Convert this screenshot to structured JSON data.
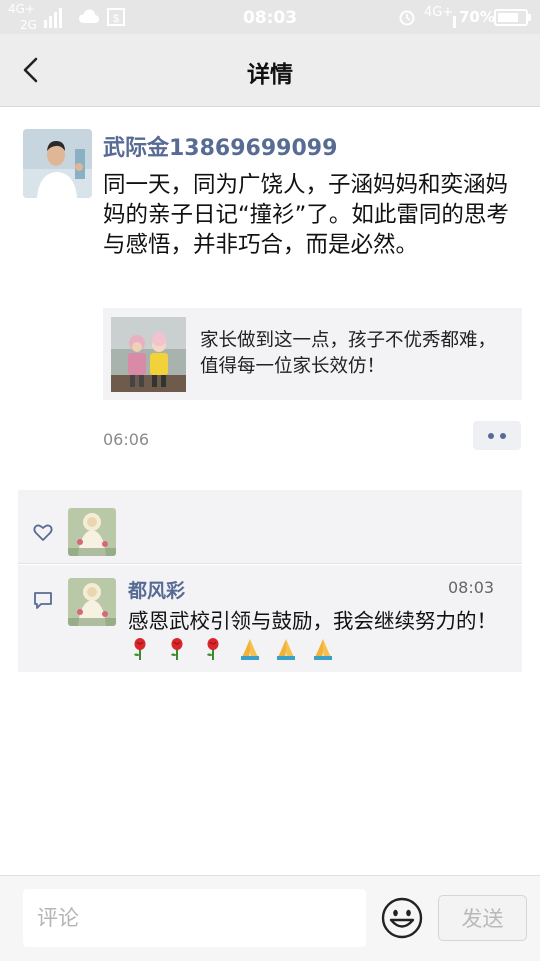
{
  "status_bar": {
    "network_1": "4G+",
    "network_2": "2G",
    "time": "08:03",
    "network_right": "4G+",
    "battery": "70%",
    "icons": [
      "signal-icon",
      "cloud-icon",
      "sim-icon",
      "alarm-icon",
      "battery-icon"
    ]
  },
  "nav": {
    "title": "详情",
    "back_icon": "chevron-left-icon"
  },
  "post": {
    "author": "武际金13869699099",
    "text": "同一天，同为广饶人，子涵妈妈和奕涵妈妈的亲子日记“撞衫”了。如此雷同的思考与感悟，并非巧合，而是必然。",
    "shared_link": {
      "title": "家长做到这一点，孩子不优秀都难，值得每一位家长效仿！"
    },
    "time": "06:06",
    "more_icon": "more-dots-icon"
  },
  "likes": {
    "icon": "heart-icon"
  },
  "comments": [
    {
      "name": "都风彩",
      "time": "08:03",
      "text": "感恩武校引领与鼓励，我会继续努力的！",
      "emojis": [
        "rose-emoji",
        "rose-emoji",
        "rose-emoji",
        "pray-emoji",
        "pray-emoji",
        "pray-emoji"
      ]
    }
  ],
  "comment_bar": {
    "placeholder": "评论",
    "emoji_icon": "smiley-icon",
    "send_label": "发送"
  },
  "colors": {
    "link_blue": "#576b95",
    "nav_bg": "#ededed",
    "card_bg": "#f3f3f5"
  }
}
